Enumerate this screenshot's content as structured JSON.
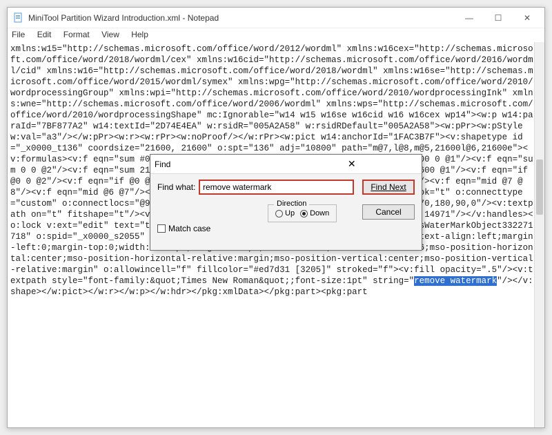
{
  "window": {
    "title": "MiniTool Partition Wizard Introduction.xml - Notepad",
    "controls": {
      "min": "—",
      "max": "☐",
      "close": "✕"
    }
  },
  "menu": {
    "file": "File",
    "edit": "Edit",
    "format": "Format",
    "view": "View",
    "help": "Help"
  },
  "find": {
    "title": "Find",
    "close": "✕",
    "label_findwhat": "Find what:",
    "value": "remove watermark",
    "btn_findnext": "Find Next",
    "btn_cancel": "Cancel",
    "dir_legend": "Direction",
    "dir_up": "Up",
    "dir_down": "Down",
    "matchcase": "Match case"
  },
  "doc": {
    "pre": "xmlns:w15=\"http://schemas.microsoft.com/office/word/2012/wordml\" xmlns:w16cex=\"http://schemas.microsoft.com/office/word/2018/wordml/cex\" xmlns:w16cid=\"http://schemas.microsoft.com/office/word/2016/wordml/cid\" xmlns:w16=\"http://schemas.microsoft.com/office/word/2018/wordml\" xmlns:w16se=\"http://schemas.microsoft.com/office/word/2015/wordml/symex\" xmlns:wpg=\"http://schemas.microsoft.com/office/word/2010/wordprocessingGroup\" xmlns:wpi=\"http://schemas.microsoft.com/office/word/2010/wordprocessingInk\" xmlns:wne=\"http://schemas.microsoft.com/office/word/2006/wordml\" xmlns:wps=\"http://schemas.microsoft.com/office/word/2010/wordprocessingShape\" mc:Ignorable=\"w14 w15 w16se w16cid w16 w16cex wp14\"><w:p w14:paraId=\"7BF877A2\" w14:textId=\"2D74E4EA\" w:rsidR=\"005A2A58\" w:rsidRDefault=\"005A2A58\"><w:pPr><w:pStyle w:val=\"a3\"/></w:pPr><w:r><w:rPr><w:noProof/></w:rPr><w:pict w14:anchorId=\"1FAC3B7F\"><v:shapetype id=\"_x0000_t136\" coordsize=\"21600, 21600\" o:spt=\"136\" adj=\"10800\" path=\"m@7,l@8,m@5,21600l@6,21600e\"><v:formulas><v:f eqn=\"sum #0 0 10800\"/><v:f eqn=\"prod #0 2 1\"/><v:f eqn=\"sum 21600 0 @1\"/><v:f eqn=\"sum 0 0 @2\"/><v:f eqn=\"sum 21600 0 @3\"/><v:f eqn=\"if @0 @3 0\"/><v:f eqn=\"if @0 21600 @1\"/><v:f eqn=\"if @0 0 @2\"/><v:f eqn=\"if @0 @4 21600\"/><v:f eqn=\"mid @5 @6\"/><v:f eqn=\"mid @8 @5\"/><v:f eqn=\"mid @7 @8\"/><v:f eqn=\"mid @6 @7\"/><v:f eqn=\"sum @6 0 @5\"/></v:formulas><v:path textpathok=\"t\" o:connecttype=\"custom\" o:connectlocs=\"@9,0;@10,10800;@11,21600;@12,10800\" o:connectangles=\"270,180,90,0\"/><v:textpath on=\"t\" fitshape=\"t\"/><v:handles><v:h position=\"#0,bottomRight\" xrange=\"6629,14971\"/></v:handles><o:lock v:ext=\"edit\" text=\"t\" shapetype=\"t\"/></v:shapetype><v:shape id=\"PowerPlusWaterMarkObject332271718\" o:spid=\"_x0000_s2055\" type=\"#_x0000_t136\" style=\"position:absolute;left:0;text-align:left;margin-left:0;margin-top:0;width:526.9pt;height:58.5pt;rotation:315;z-index:-251657216;mso-position-horizontal:center;mso-position-horizontal-relative:margin;mso-position-vertical:center;mso-position-vertical-relative:margin\" o:allowincell=\"f\" fillcolor=\"#ed7d31 [3205]\" stroked=\"f\"><v:fill opacity=\".5\"/><v:textpath style=\"font-family:&quot;Times New Roman&quot;;font-size:1pt\" string=\"",
    "hl": "remove watermark",
    "post": "\"/></v:shape></w:pict></w:r></w:p></w:hdr></pkg:xmlData></pkg:part><pkg:part"
  }
}
